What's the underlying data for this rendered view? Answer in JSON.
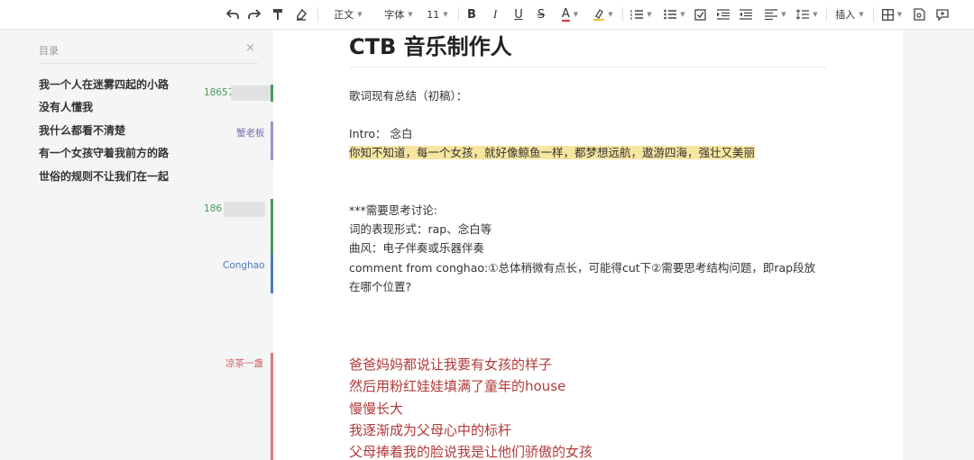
{
  "toolbar": {
    "paragraph_style": "正文",
    "font_family": "字体",
    "font_size": "11",
    "insert_label": "插入"
  },
  "toc": {
    "title": "目录",
    "close": "×",
    "items": [
      "我一个人在迷雾四起的小路",
      "没有人懂我",
      "我什么都看不清楚",
      "有一个女孩守着我前方的路",
      "世俗的规则不让我们在一起"
    ]
  },
  "comments": [
    {
      "name": "18657",
      "color": "#4a9a5a"
    },
    {
      "name": "蟹老板",
      "color": "#7b6cb0"
    },
    {
      "name": "186",
      "color": "#4a9a5a"
    },
    {
      "name": "Conghao",
      "color": "#4a7cc0"
    },
    {
      "name": "凉茶一盏",
      "color": "#d25a5a"
    }
  ],
  "document": {
    "title": "CTB 音乐制作人",
    "summary": "歌词现有总结（初稿）：",
    "intro": "Intro： 念白",
    "highlighted": "你知不知道，每一个女孩，就好像鲸鱼一样，都梦想远航，遨游四海，强壮又美丽",
    "discussion_heading": "***需要思考讨论:",
    "discussion_1": "词的表现形式：rap、念白等",
    "discussion_2": "曲风：电子伴奏或乐器伴奏",
    "discussion_3": "comment from conghao:①总体稍微有点长，可能得cut下②需要思考结构问题，即rap段放",
    "discussion_4": "在哪个位置?",
    "lyrics": [
      "爸爸妈妈都说让我要有女孩的样子",
      "然后用粉红娃娃填满了童年的house",
      "慢慢长大",
      "我逐渐成为父母心中的标杆",
      "父母捧着我的脸说我是让他们骄傲的女孩"
    ]
  },
  "colors": {
    "highlight": "#f7e6a0",
    "lyric_text": "#b23a3a"
  }
}
